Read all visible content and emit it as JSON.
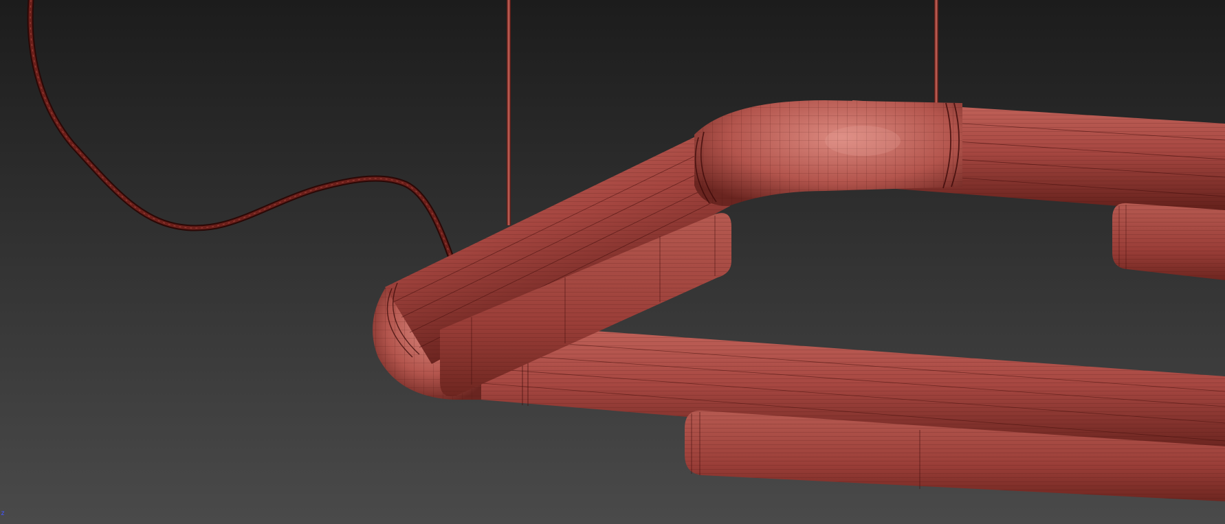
{
  "viewport": {
    "background_top": "#1c1c1c",
    "background_bottom": "#4a4a4a",
    "axis_label": "z",
    "axis_color": "#4455ff"
  },
  "model": {
    "material_color": "#a9483f",
    "material_highlight": "#d2766c",
    "material_shadow": "#5c1c17",
    "wire_color": "#3f0c0a",
    "cable_color": "#431210",
    "rod_color": "#b85a50"
  }
}
